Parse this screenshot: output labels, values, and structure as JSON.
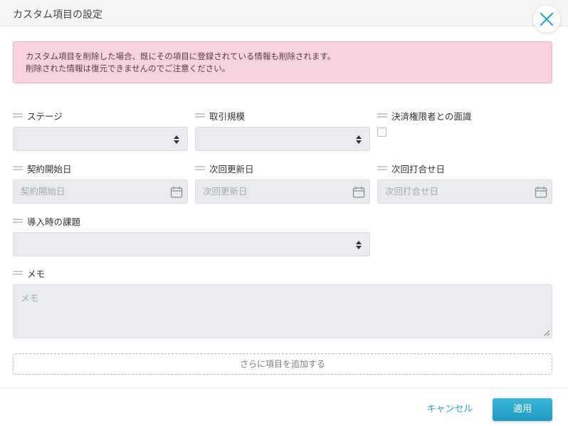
{
  "header": {
    "title": "カスタム項目の設定"
  },
  "alert": {
    "line1": "カスタム項目を削除した場合、既にその項目に登録されている情報も削除されます。",
    "line2": "削除された情報は復元できませんのでご注意ください。"
  },
  "fields": {
    "stage": {
      "label": "ステージ"
    },
    "deal_size": {
      "label": "取引規模"
    },
    "decision_maker_meeting": {
      "label": "決済権限者との面識"
    },
    "contract_start": {
      "label": "契約開始日",
      "placeholder": "契約開始日"
    },
    "next_renewal": {
      "label": "次回更新日",
      "placeholder": "次回更新日"
    },
    "next_meeting": {
      "label": "次回打合せ日",
      "placeholder": "次回打合せ日"
    },
    "adoption_issue": {
      "label": "導入時の課題"
    },
    "memo": {
      "label": "メモ",
      "placeholder": "メモ"
    }
  },
  "add_more_label": "さらに項目を追加する",
  "footer": {
    "cancel_label": "キャンセル",
    "apply_label": "適用"
  },
  "colors": {
    "accent": "#1fa3cb",
    "alert_bg": "#f8d3dd",
    "input_bg": "#e9ebee"
  },
  "icons": {
    "close": "close-x-icon",
    "calendar": "calendar-icon",
    "select": "select-arrows-icon",
    "drag": "drag-handle-icon"
  }
}
